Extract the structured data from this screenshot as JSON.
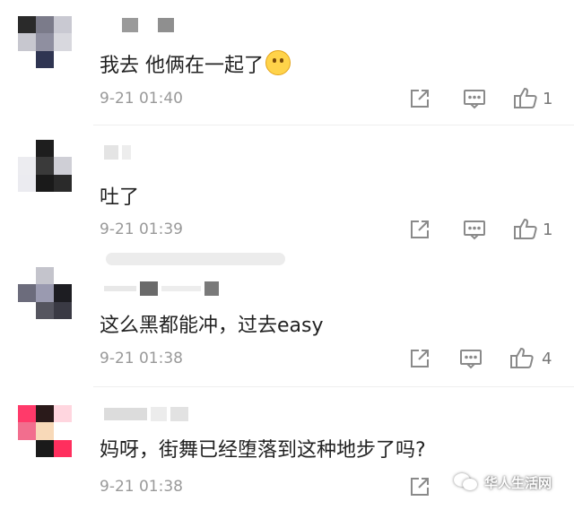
{
  "comments": [
    {
      "text": "我去 他俩在一起了",
      "emoji": "flushed-face-emoji",
      "time": "9-21 01:40",
      "likes": "1"
    },
    {
      "text": "吐了",
      "time": "9-21 01:39",
      "likes": "1"
    },
    {
      "text": "这么黑都能冲，过去easy",
      "time": "9-21 01:38",
      "likes": "4"
    },
    {
      "text": "妈呀，街舞已经堕落到这种地步了吗?",
      "time": "9-21 01:38",
      "likes": ""
    }
  ],
  "watermark": {
    "text": "华人生活网",
    "icon": "wechat-icon"
  },
  "colors": {
    "text": "#222222",
    "meta": "#999999",
    "icon": "#8a8a8a"
  }
}
